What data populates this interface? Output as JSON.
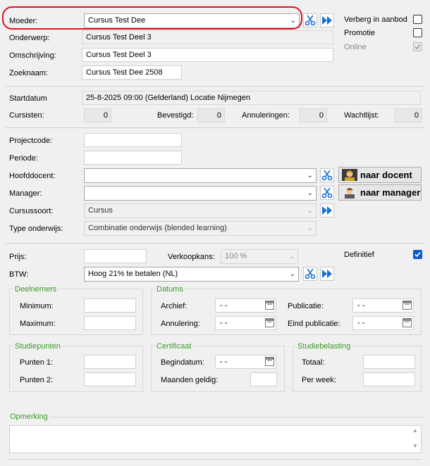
{
  "form": {
    "moeder": {
      "label": "Moeder:",
      "value": "Cursus Test Dee"
    },
    "onderwerp": {
      "label": "Onderwerp:",
      "value": "Cursus Test Deel 3"
    },
    "omschrijving": {
      "label": "Omschrijving:",
      "value": "Cursus Test Deel 3"
    },
    "zoeknaam": {
      "label": "Zoeknaam:",
      "value": "Cursus Test Dee 2508"
    },
    "verberg": {
      "label": "Verberg in aanbod",
      "checked": false
    },
    "promotie": {
      "label": "Promotie",
      "checked": false
    },
    "online": {
      "label": "Online",
      "checked": true
    },
    "startdatum": {
      "label": "Startdatum",
      "value": "25-8-2025 09:00 (Gelderland) Locatie Nijmegen"
    },
    "cursisten": {
      "label": "Cursisten:",
      "value": "0"
    },
    "bevestigd": {
      "label": "Bevestigd:",
      "value": "0"
    },
    "annuleringen": {
      "label": "Annuleringen:",
      "value": "0"
    },
    "wachtlijst": {
      "label": "Wachtlijst:",
      "value": "0"
    },
    "projectcode": {
      "label": "Projectcode:",
      "value": ""
    },
    "periode": {
      "label": "Periode:",
      "value": ""
    },
    "hoofddocent": {
      "label": "Hoofddocent:",
      "value": ""
    },
    "manager": {
      "label": "Manager:",
      "value": ""
    },
    "cursussoort": {
      "label": "Cursussoort:",
      "value": "Cursus"
    },
    "type_onderwijs": {
      "label": "Type onderwijs:",
      "value": "Combinatie onderwijs (blended learning)"
    },
    "naar_docent": "naar docent",
    "naar_manager": "naar manager",
    "prijs": {
      "label": "Prijs:",
      "value": ""
    },
    "verkoopkans": {
      "label": "Verkoopkans:",
      "value": "100 %"
    },
    "definitief": {
      "label": "Definitief",
      "checked": true
    },
    "btw": {
      "label": "BTW:",
      "value": "Hoog 21% te betalen (NL)"
    }
  },
  "groups": {
    "deelnemers": {
      "title": "Deelnemers",
      "minimum": "Minimum:",
      "maximum": "Maximum:"
    },
    "datums": {
      "title": "Datums",
      "archief": "Archief:",
      "annulering": "Annulering:",
      "publicatie": "Publicatie:",
      "eind_publicatie": "Eind publicatie:",
      "date_empty": "-  -"
    },
    "studiepunten": {
      "title": "Studiepunten",
      "punten1": "Punten 1:",
      "punten2": "Punten 2:"
    },
    "certificaat": {
      "title": "Certificaat",
      "begindatum": "Begindatum:",
      "maanden": "Maanden geldig:"
    },
    "studiebelasting": {
      "title": "Studiebelasting",
      "totaal": "Totaal:",
      "per_week": "Per week:"
    }
  },
  "opmerking": {
    "title": "Opmerking",
    "value": ""
  },
  "colors": {
    "highlight": "#d8161f",
    "group_title": "#3a9a2a",
    "checkbox_on": "#0a5ec9",
    "icon_blue": "#1a6fd8"
  },
  "icons": [
    "scissors-icon",
    "double-arrow-icon",
    "calendar-icon",
    "teacher-avatar-icon",
    "manager-avatar-icon",
    "chevron-down-icon"
  ]
}
